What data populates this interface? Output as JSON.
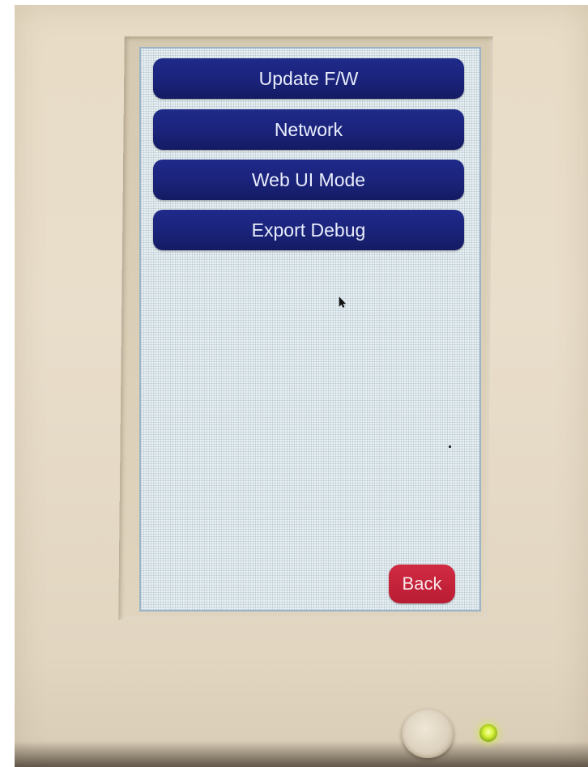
{
  "screen": {
    "menu": {
      "items": [
        {
          "label": "Update F/W"
        },
        {
          "label": "Network"
        },
        {
          "label": "Web UI Mode"
        },
        {
          "label": "Export Debug"
        }
      ]
    },
    "back_label": "Back"
  },
  "device": {
    "power_button_icon": "round-hardware-button",
    "status_led_color": "#d8f43a"
  },
  "colors": {
    "menu_button": "#1a2278",
    "back_button": "#c0223a",
    "screen_background": "#e8f1f5",
    "device_body": "#e8dcc6"
  }
}
